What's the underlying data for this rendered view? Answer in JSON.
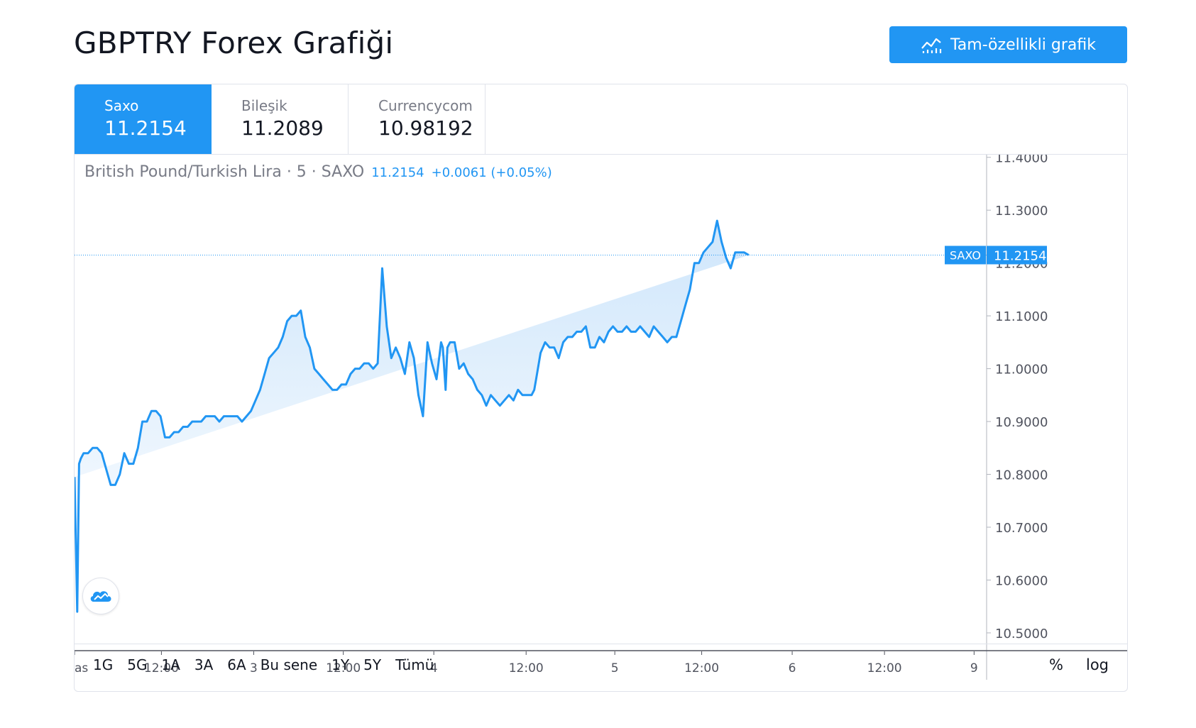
{
  "header": {
    "title": "GBPTRY Forex Grafiği",
    "full_chart_button": "Tam-özellikli grafik"
  },
  "tabs": [
    {
      "label": "Saxo",
      "value": "11.2154",
      "active": true
    },
    {
      "label": "Bileşik",
      "value": "11.2089",
      "active": false
    },
    {
      "label": "Currencycom",
      "value": "10.98192",
      "active": false
    }
  ],
  "legend": {
    "symbol": "British Pound/Turkish Lira · 5 · SAXO",
    "price": "11.2154",
    "change": "+0.0061 (+0.05%)"
  },
  "price_tag": {
    "source": "SAXO",
    "value": "11.2154"
  },
  "range_buttons": [
    "1G",
    "5G",
    "1A",
    "3A",
    "6A",
    "Bu sene",
    "1Y",
    "5Y",
    "Tümü"
  ],
  "scale_buttons": [
    "%",
    "log"
  ],
  "colors": {
    "accent": "#2196f3",
    "line": "#2196f3",
    "area_top": "#cfe6fb",
    "area_bottom": "#ffffff"
  },
  "chart_data": {
    "type": "area",
    "y_ticks": [
      "11.4000",
      "11.3000",
      "11.2000",
      "11.1000",
      "11.0000",
      "10.9000",
      "10.8000",
      "10.7000",
      "10.6000",
      "10.5000"
    ],
    "ylim": [
      10.465,
      11.405
    ],
    "x_ticks": [
      {
        "label": "as",
        "pos": 0.0
      },
      {
        "label": "12:00",
        "pos": 0.096
      },
      {
        "label": "3",
        "pos": 0.198
      },
      {
        "label": "12:00",
        "pos": 0.297
      },
      {
        "label": "4",
        "pos": 0.397
      },
      {
        "label": "12:00",
        "pos": 0.499
      },
      {
        "label": "5",
        "pos": 0.597
      },
      {
        "label": "12:00",
        "pos": 0.693
      },
      {
        "label": "6",
        "pos": 0.793
      },
      {
        "label": "12:00",
        "pos": 0.895
      },
      {
        "label": "9",
        "pos": 0.994
      }
    ],
    "x": [
      0.0,
      0.003,
      0.005,
      0.007,
      0.01,
      0.015,
      0.02,
      0.025,
      0.03,
      0.035,
      0.04,
      0.045,
      0.05,
      0.055,
      0.06,
      0.065,
      0.07,
      0.075,
      0.08,
      0.085,
      0.09,
      0.095,
      0.1,
      0.105,
      0.11,
      0.115,
      0.12,
      0.125,
      0.13,
      0.135,
      0.14,
      0.145,
      0.15,
      0.155,
      0.16,
      0.165,
      0.17,
      0.175,
      0.18,
      0.185,
      0.19,
      0.195,
      0.2,
      0.205,
      0.21,
      0.215,
      0.22,
      0.225,
      0.23,
      0.235,
      0.24,
      0.245,
      0.25,
      0.255,
      0.26,
      0.265,
      0.27,
      0.275,
      0.28,
      0.285,
      0.29,
      0.295,
      0.3,
      0.305,
      0.31,
      0.315,
      0.32,
      0.325,
      0.33,
      0.335,
      0.34,
      0.345,
      0.35,
      0.355,
      0.36,
      0.365,
      0.37,
      0.375,
      0.38,
      0.385,
      0.39,
      0.395,
      0.4,
      0.405,
      0.407,
      0.41,
      0.412,
      0.415,
      0.42,
      0.425,
      0.43,
      0.435,
      0.44,
      0.445,
      0.45,
      0.455,
      0.46,
      0.465,
      0.47,
      0.475,
      0.48,
      0.485,
      0.49,
      0.495,
      0.5,
      0.505,
      0.508,
      0.51,
      0.515,
      0.52,
      0.525,
      0.53,
      0.535,
      0.54,
      0.545,
      0.55,
      0.555,
      0.56,
      0.565,
      0.57,
      0.575,
      0.58,
      0.585,
      0.59,
      0.595,
      0.6,
      0.605,
      0.61,
      0.615,
      0.62,
      0.625,
      0.63,
      0.635,
      0.64,
      0.645,
      0.65,
      0.655,
      0.66,
      0.665,
      0.67,
      0.675,
      0.68,
      0.685,
      0.69,
      0.695,
      0.7,
      0.705,
      0.71,
      0.715,
      0.72,
      0.725,
      0.73,
      0.735,
      0.74,
      0.745,
      0.75,
      0.755,
      0.76,
      0.765,
      0.77,
      0.775,
      0.78,
      0.785,
      0.79,
      0.795,
      0.8,
      0.805,
      0.81,
      0.815,
      0.82,
      0.825,
      0.83,
      0.835,
      0.84,
      0.845,
      0.85,
      0.855,
      0.86,
      0.865,
      0.87,
      0.875,
      0.88,
      0.885,
      0.89,
      0.895,
      0.9,
      0.905,
      0.91,
      0.915,
      0.92,
      0.925,
      0.93,
      0.935,
      0.94,
      0.945,
      0.95,
      0.955,
      0.96,
      0.965,
      0.97,
      0.975,
      0.98,
      0.985,
      0.99,
      0.994
    ],
    "values": [
      10.795,
      10.54,
      10.82,
      10.83,
      10.84,
      10.84,
      10.85,
      10.85,
      10.84,
      10.81,
      10.78,
      10.78,
      10.8,
      10.84,
      10.82,
      10.82,
      10.85,
      10.9,
      10.9,
      10.92,
      10.92,
      10.91,
      10.87,
      10.87,
      10.88,
      10.88,
      10.89,
      10.89,
      10.9,
      10.9,
      10.9,
      10.91,
      10.91,
      10.91,
      10.9,
      10.91,
      10.91,
      10.91,
      10.91,
      10.9,
      10.91,
      10.92,
      10.94,
      10.96,
      10.99,
      11.02,
      11.03,
      11.04,
      11.06,
      11.09,
      11.1,
      11.1,
      11.11,
      11.06,
      11.04,
      11.0,
      10.99,
      10.98,
      10.97,
      10.96,
      10.96,
      10.97,
      10.97,
      10.99,
      11.0,
      11.0,
      11.01,
      11.01,
      11.0,
      11.01,
      11.19,
      11.08,
      11.02,
      11.04,
      11.02,
      10.99,
      11.05,
      11.02,
      10.95,
      10.91,
      11.05,
      11.01,
      10.98,
      11.05,
      11.04,
      10.96,
      11.04,
      11.05,
      11.05,
      11.0,
      11.01,
      10.99,
      10.98,
      10.96,
      10.95,
      10.93,
      10.95,
      10.94,
      10.93,
      10.94,
      10.95,
      10.94,
      10.96,
      10.95,
      10.95,
      10.95,
      10.96,
      10.98,
      11.03,
      11.05,
      11.04,
      11.04,
      11.02,
      11.05,
      11.06,
      11.06,
      11.07,
      11.07,
      11.08,
      11.04,
      11.04,
      11.06,
      11.05,
      11.07,
      11.08,
      11.07,
      11.07,
      11.08,
      11.07,
      11.07,
      11.08,
      11.07,
      11.06,
      11.08,
      11.07,
      11.06,
      11.05,
      11.06,
      11.06,
      11.09,
      11.12,
      11.15,
      11.2,
      11.2,
      11.22,
      11.23,
      11.24,
      11.28,
      11.24,
      11.21,
      11.19,
      11.22,
      11.22,
      11.22,
      11.215
    ],
    "series_name": "SAXO"
  }
}
